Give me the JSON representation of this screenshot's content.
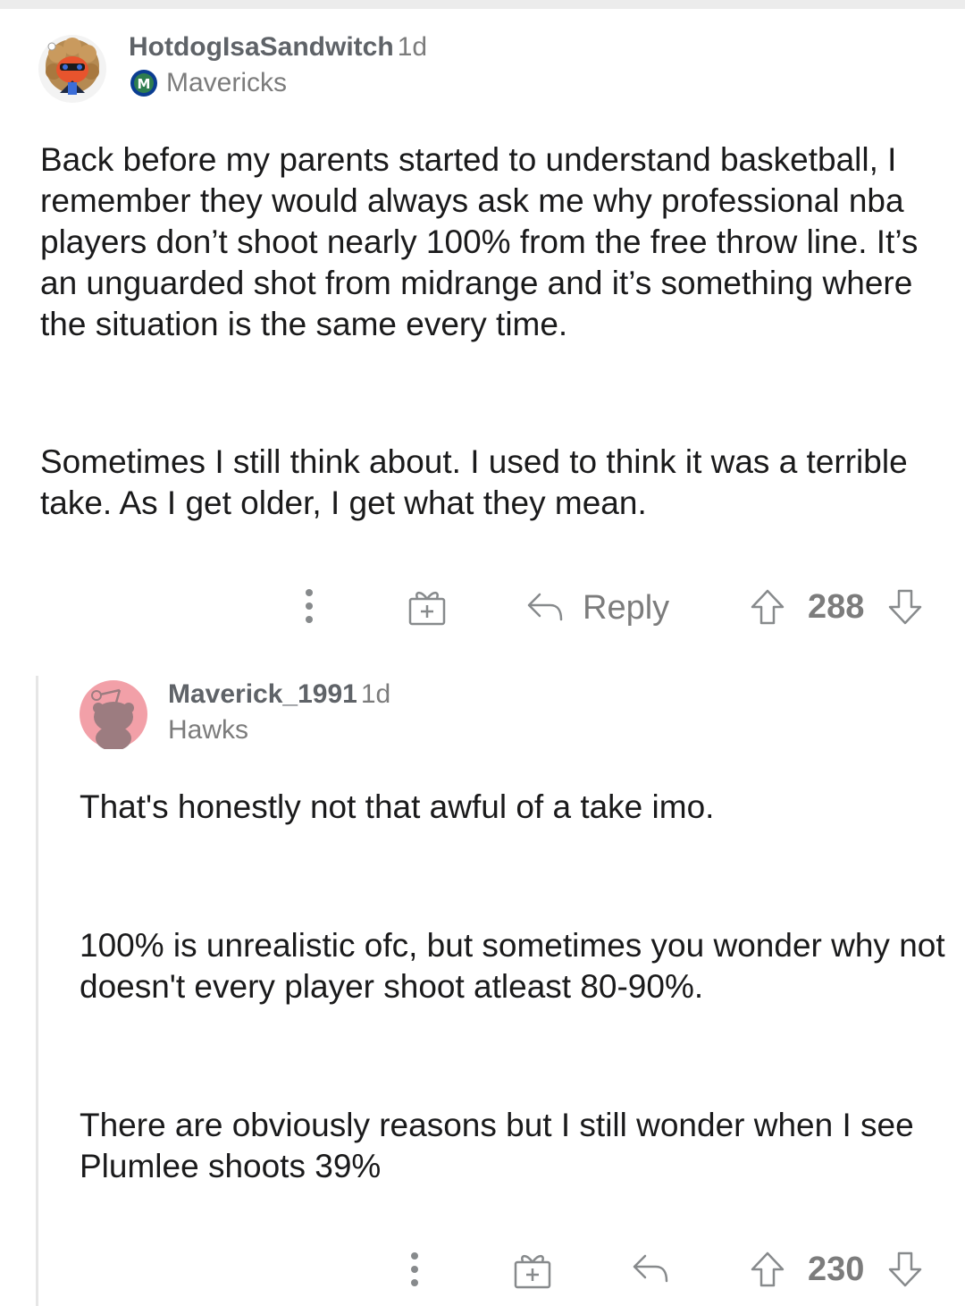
{
  "comments": [
    {
      "username": "HotdogIsaSandwitch",
      "age": "1d",
      "flair": "Mavericks",
      "paragraphs": [
        "Back before my parents started to understand basketball, I remember they would always ask me why professional nba players don’t shoot nearly 100% from the free throw line. It’s an unguarded shot from midrange and it’s something where the situation is the same every time.",
        "Sometimes I still think about. I used to think it was a terrible take. As I get older, I get what they mean."
      ],
      "actions": {
        "reply_label": "Reply",
        "score": "288"
      }
    },
    {
      "username": "Maverick_1991",
      "age": "1d",
      "flair": "Hawks",
      "paragraphs": [
        "That's honestly not that awful of a take imo.",
        "100% is unrealistic ofc, but sometimes you wonder why not doesn't every player shoot atleast 80-90%.",
        "There are obviously reasons but I still wonder when I see Plumlee shoots 39%"
      ],
      "actions": {
        "score": "230"
      }
    }
  ],
  "icons": {
    "more": "more-vertical-icon",
    "award": "gift-award-icon",
    "reply": "reply-arrow-icon",
    "upvote": "upvote-arrow-icon",
    "downvote": "downvote-arrow-icon",
    "flair_logo": "mavericks-logo-icon"
  },
  "colors": {
    "text": "#1a1a1b",
    "meta": "#7c7c7c",
    "icon": "#878a8c",
    "thread_line": "#e6e6e6",
    "avatar2_bg": "#f2a0a8"
  }
}
